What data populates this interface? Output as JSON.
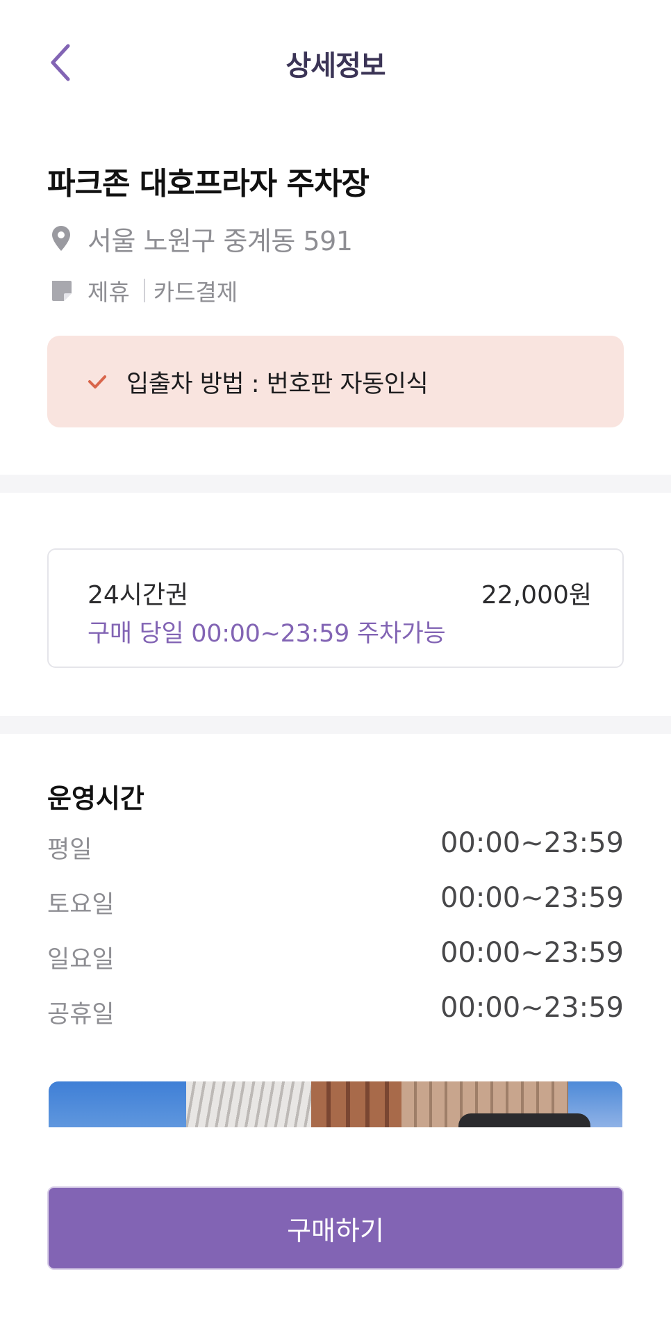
{
  "header": {
    "back_icon": "chevron-left-icon",
    "title": "상세정보"
  },
  "lot": {
    "name": "파크존 대호프라자 주차장",
    "address_icon": "location-pin-icon",
    "address": "서울 노원구 중계동 591",
    "tags_icon": "note-icon",
    "tags": [
      "제휴",
      "카드결제"
    ]
  },
  "notice": {
    "icon": "check-icon",
    "text": "입출차 방법 : 번호판 자동인식",
    "background": "#f9e4df",
    "icon_color": "#d9654b"
  },
  "ticket": {
    "name": "24시간권",
    "price": "22,000원",
    "description": "구매 당일 00:00~23:59 주차가능",
    "accent_color": "#8264b4"
  },
  "hours": {
    "title": "운영시간",
    "rows": [
      {
        "day": "평일",
        "time": "00:00~23:59"
      },
      {
        "day": "토요일",
        "time": "00:00~23:59"
      },
      {
        "day": "일요일",
        "time": "00:00~23:59"
      },
      {
        "day": "공휴일",
        "time": "00:00~23:59"
      }
    ]
  },
  "actions": {
    "buy_label": "구매하기",
    "buy_color": "#8264b4"
  }
}
